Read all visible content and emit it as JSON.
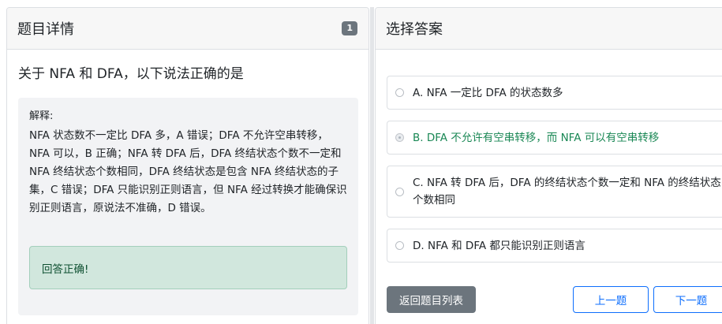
{
  "left_panel": {
    "title": "题目详情",
    "badge": "1",
    "question": "关于 NFA 和 DFA，以下说法正确的是",
    "explanation_title": "解释:",
    "explanation_text": "NFA 状态数不一定比 DFA 多，A 错误；DFA 不允许空串转移，NFA 可以，B 正确；NFA 转 DFA 后，DFA 终结状态个数不一定和 NFA 终结状态个数相同，DFA 终结状态是包含 NFA 终结状态的子集，C 错误；DFA 只能识别正则语言，但 NFA 经过转换才能确保识别正则语言，原说法不准确，D 错误。",
    "result": "回答正确!"
  },
  "right_panel": {
    "title": "选择答案",
    "options": [
      {
        "label": "A. NFA 一定比 DFA 的状态数多",
        "checked": false
      },
      {
        "label": "B. DFA 不允许有空串转移，而 NFA 可以有空串转移",
        "checked": true
      },
      {
        "label": "C. NFA 转 DFA 后，DFA 的终结状态个数一定和 NFA 的终结状态个数相同",
        "checked": false
      },
      {
        "label": "D. NFA 和 DFA 都只能识别正则语言",
        "checked": false
      }
    ],
    "back_button": "返回题目列表",
    "prev_button": "上一题",
    "next_button": "下一题"
  }
}
